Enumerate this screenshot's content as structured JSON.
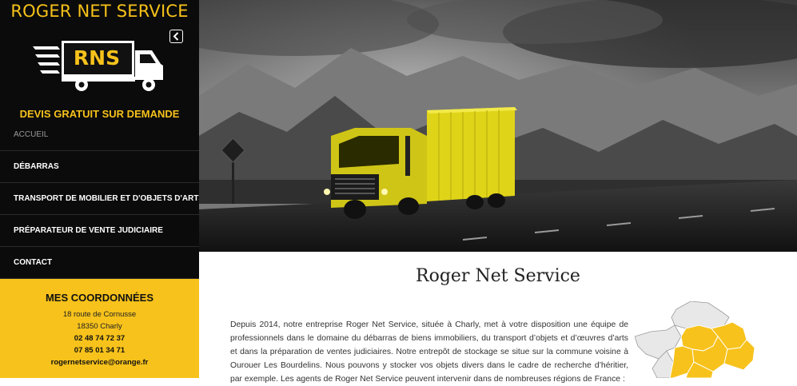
{
  "brand": {
    "title": "ROGER NET SERVICE",
    "logo_text": "RNS",
    "tagline": "DEVIS GRATUIT SUR DEMANDE",
    "accent_color": "#f7c21b"
  },
  "sidebar": {
    "collapse_icon": "chevron-left-icon",
    "nav": [
      {
        "label": "ACCUEIL",
        "active": true
      },
      {
        "label": "DÉBARRAS",
        "active": false
      },
      {
        "label": "TRANSPORT DE MOBILIER ET D'OBJETS D'ARTS",
        "active": false
      },
      {
        "label": "PRÉPARATEUR DE VENTE JUDICIAIRE",
        "active": false
      },
      {
        "label": "CONTACT",
        "active": false
      }
    ]
  },
  "contact": {
    "title": "MES COORDONNÉES",
    "address_line1": "18 route de Cornusse",
    "address_line2": "18350 Charly",
    "phone1": "02 48 74 72 37",
    "phone2": "07 85 01 34 71",
    "email": "rogernetservice@orange.fr"
  },
  "hero": {
    "image": "truck-on-mountain-road"
  },
  "main": {
    "title": "Roger Net Service",
    "intro": "Depuis 2014, notre entreprise Roger Net Service, située à Charly, met à votre disposition une équipe de professionnels dans le domaine du débarras de biens immobiliers, du transport d’objets et d’œuvres d’arts et dans la préparation de ventes judiciaires. Notre entrepôt de stockage se situe sur la commune voisine à Ourouer Les Bourdelins. Nous pouvons y stocker vos objets divers dans le cadre de recherche d’héritier, par exemple. Les agents de Roger Net Service peuvent intervenir dans de nombreuses régions de France :"
  }
}
